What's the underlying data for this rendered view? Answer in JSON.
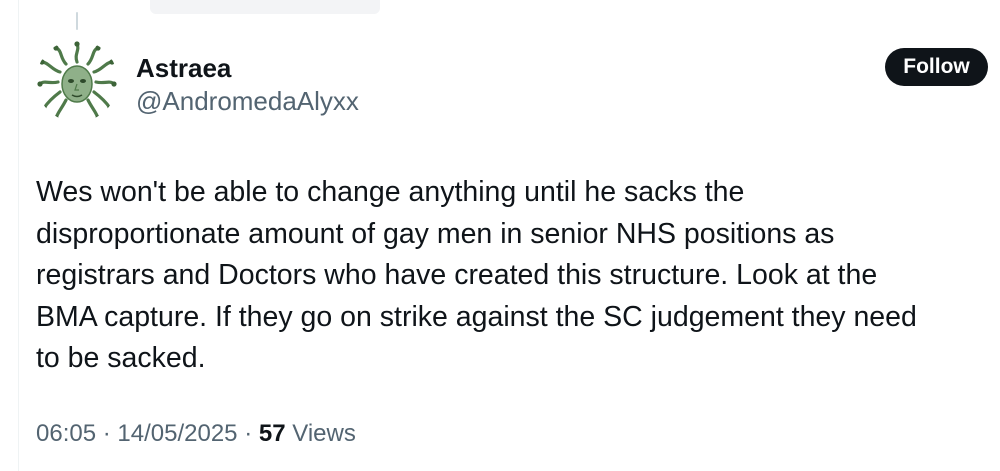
{
  "author": {
    "display_name": "Astraea",
    "handle": "@AndromedaAlyxx",
    "avatar_icon": "medusa-avatar"
  },
  "follow_button": {
    "label": "Follow"
  },
  "tweet": {
    "lines": [
      "Wes won't be able to change anything until he sacks the",
      "disproportionate amount of gay men in senior NHS positions as",
      "registrars and Doctors who have created this structure. Look at the",
      "BMA capture. If they go on strike against the SC judgement they need",
      "to be sacked."
    ]
  },
  "meta": {
    "time": "06:05",
    "separator": "·",
    "date": "14/05/2025",
    "views_count": "57",
    "views_label": "Views"
  },
  "colors": {
    "text_primary": "#0f1419",
    "text_secondary": "#536471",
    "button_bg": "#0f1419",
    "button_text": "#ffffff",
    "avatar_green": "#5f8a5a"
  }
}
